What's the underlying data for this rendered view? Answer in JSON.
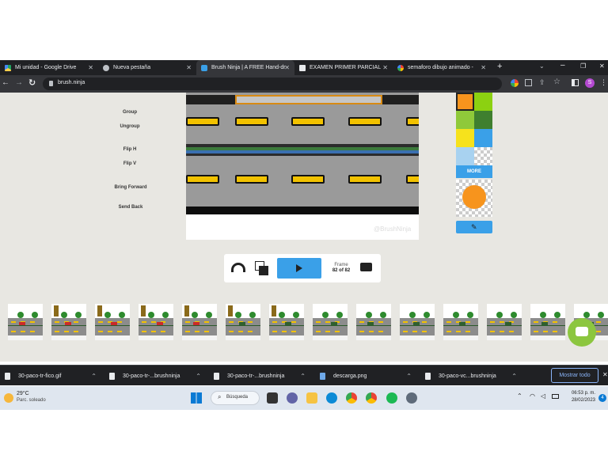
{
  "tabs": [
    {
      "label": "Mi unidad - Google Drive",
      "icon": "google-drive-icon",
      "active": false
    },
    {
      "label": "Nueva pestaña",
      "icon": "chrome-icon",
      "active": false
    },
    {
      "label": "Brush Ninja | A FREE Hand-dr",
      "icon": "brush-ninja-icon",
      "active": true
    },
    {
      "label": "EXAMEN PRIMER PARCIAL",
      "icon": "classroom-icon",
      "active": false
    },
    {
      "label": "semaforo dibujo animado - ",
      "icon": "google-icon",
      "active": false
    }
  ],
  "address": {
    "url": "brush.ninja"
  },
  "left_menu": {
    "group": "Group",
    "ungroup": "Ungroup",
    "flip_h": "Flip H",
    "flip_v": "Flip V",
    "bring_forward": "Bring Forward",
    "send_back": "Send Back"
  },
  "canvas": {
    "watermark": "@BrushNinja"
  },
  "playback": {
    "frame_label": "Frame",
    "frame_value": "82 of 82"
  },
  "palette": {
    "colors": [
      "#f7941d",
      "#8cd111",
      "#8fc93a",
      "#3f7f2f",
      "#f6e21c",
      "#3aa0e8",
      "#a8d2f0",
      "transparent"
    ],
    "more_label": "MORE"
  },
  "filmstrip": {
    "count": 14
  },
  "downloads": [
    {
      "name": "30-paco-tr-fico.gif"
    },
    {
      "name": "30-paco-tr-...brushninja"
    },
    {
      "name": "30-paco-tr-...brushninja"
    },
    {
      "name": "descarga.png"
    },
    {
      "name": "30-paco-vc...brushninja"
    }
  ],
  "downloads_show_all": "Mostrar todo",
  "taskbar": {
    "weather_temp": "29°C",
    "weather_desc": "Parc. soleado",
    "search_label": "Búsqueda",
    "time": "06:53 p. m.",
    "date": "28/02/2023",
    "notification_count": "4"
  },
  "colors": {
    "accent": "#3aa0e8",
    "chrome_dark": "#202124"
  }
}
